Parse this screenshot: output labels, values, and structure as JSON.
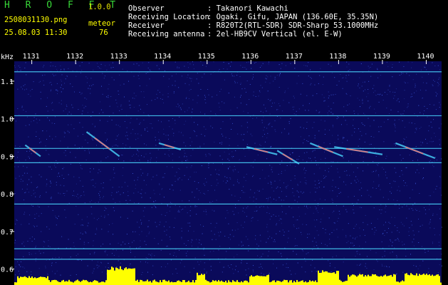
{
  "header": {
    "app_name": "H R O F F T",
    "app_version": "1.0.0",
    "filename": "2508031130.png",
    "mode_label": "meteor",
    "timestamp": "25.08.03 11:30",
    "count": "76",
    "info": [
      {
        "label": "Observer",
        "value": ": Takanori Kawachi"
      },
      {
        "label": "Receiving Location",
        "value": ": Ogaki, Gifu, JAPAN (136.60E, 35.35N)"
      },
      {
        "label": "Receiver",
        "value": ": R820T2(RTL-SDR) SDR-Sharp 53.1000MHz"
      },
      {
        "label": "Receiving antenna",
        "value": ": 2el-HB9CV Vertical (el. E-W)"
      }
    ]
  },
  "colors": {
    "background": "#0a0a5a",
    "noise": "#3a56d8",
    "carrier": "#4ad8ff",
    "echo_core": "#ff6a6a",
    "activity": "#ffff00",
    "axis_text": "#ffffff"
  },
  "chart_data": {
    "type": "heatmap",
    "ylabel": "kHz",
    "x_ticks": [
      "1131",
      "1132",
      "1133",
      "1134",
      "1135",
      "1136",
      "1137",
      "1138",
      "1139",
      "1140"
    ],
    "y_ticks": [
      "1.1",
      "1.0",
      "0.9",
      "0.8",
      "0.7",
      "0.6"
    ],
    "y_tick_values": [
      1.1,
      1.0,
      0.9,
      0.8,
      0.7,
      0.6
    ],
    "x_range": [
      1130.6,
      1140.35
    ],
    "y_range": [
      0.584,
      1.153
    ],
    "carriers_khz": [
      1.125,
      1.008,
      0.921,
      0.883,
      0.773,
      0.654,
      0.626
    ],
    "echoes": [
      {
        "x0": 1130.85,
        "x1": 1131.2,
        "y0": 0.93,
        "y1": 0.9
      },
      {
        "x0": 1132.25,
        "x1": 1133.0,
        "y0": 0.965,
        "y1": 0.9
      },
      {
        "x0": 1133.9,
        "x1": 1134.4,
        "y0": 0.935,
        "y1": 0.918
      },
      {
        "x0": 1135.9,
        "x1": 1136.6,
        "y0": 0.925,
        "y1": 0.905
      },
      {
        "x0": 1136.6,
        "x1": 1137.1,
        "y0": 0.915,
        "y1": 0.88
      },
      {
        "x0": 1137.35,
        "x1": 1138.1,
        "y0": 0.935,
        "y1": 0.9
      },
      {
        "x0": 1137.9,
        "x1": 1139.0,
        "y0": 0.925,
        "y1": 0.905
      },
      {
        "x0": 1139.3,
        "x1": 1140.2,
        "y0": 0.935,
        "y1": 0.895
      }
    ],
    "activity_bursts": [
      {
        "x0": 1130.65,
        "x1": 1131.35,
        "level": 0.45
      },
      {
        "x0": 1132.7,
        "x1": 1133.35,
        "level": 0.95
      },
      {
        "x0": 1134.75,
        "x1": 1134.95,
        "level": 0.65
      },
      {
        "x0": 1135.95,
        "x1": 1136.4,
        "level": 0.55
      },
      {
        "x0": 1137.5,
        "x1": 1138.0,
        "level": 0.75
      },
      {
        "x0": 1138.2,
        "x1": 1139.3,
        "level": 0.55
      },
      {
        "x0": 1139.5,
        "x1": 1140.3,
        "level": 0.6
      }
    ]
  }
}
